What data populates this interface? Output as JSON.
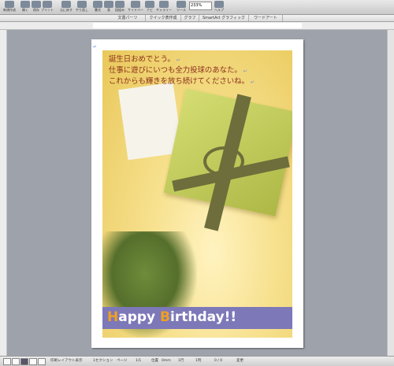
{
  "toolbar": {
    "items": [
      {
        "label": "新規作成",
        "icon": "new-doc-icon"
      },
      {
        "label": "開く",
        "icon": "open-icon"
      },
      {
        "label": "保存",
        "icon": "save-icon"
      },
      {
        "label": "プリント",
        "icon": "print-icon"
      },
      {
        "label": "元に戻す",
        "icon": "undo-icon"
      },
      {
        "label": "やり直し",
        "icon": "redo-icon"
      },
      {
        "label": "書式",
        "icon": "format-icon"
      },
      {
        "label": "表",
        "icon": "table-icon"
      },
      {
        "label": "段組み",
        "icon": "columns-icon"
      },
      {
        "label": "サイドバー",
        "icon": "sidebar-icon"
      },
      {
        "label": "ナビ",
        "icon": "nav-icon"
      },
      {
        "label": "ギャラリー",
        "icon": "gallery-icon"
      },
      {
        "label": "ツール",
        "icon": "tool-icon"
      },
      {
        "label": "ズーム",
        "icon": "zoom-icon"
      },
      {
        "label": "ヘルプ",
        "icon": "help-icon"
      }
    ],
    "zoom_value": "233%"
  },
  "ribbon_tabs": [
    "文書パーツ",
    "クイック表作成",
    "グラフ",
    "SmartArt グラフィック",
    "ワードアート"
  ],
  "document": {
    "greeting_lines": [
      "誕生日おめでとう。",
      "仕事に遊びにいつも全力投球のあなた。",
      "これからも輝きを放ち続けてくださいね。"
    ],
    "banner": {
      "parts": [
        {
          "text": "H",
          "style": "orange"
        },
        {
          "text": "appy ",
          "style": "white"
        },
        {
          "text": "B",
          "style": "orange"
        },
        {
          "text": "irthday!!",
          "style": "white"
        }
      ]
    },
    "colors": {
      "banner_bg": "#7d78b8",
      "accent_orange": "#f0a020",
      "greeting_text": "#8a2f1c"
    }
  },
  "statusbar": {
    "view": "印刷レイアウト表示",
    "section": "1セクション",
    "page_label": "ページ",
    "page_value": "1/1",
    "position": "位置",
    "position_value": "0mm",
    "line": "1行",
    "column": "1列",
    "words": "0 / 0",
    "track": "変更"
  }
}
